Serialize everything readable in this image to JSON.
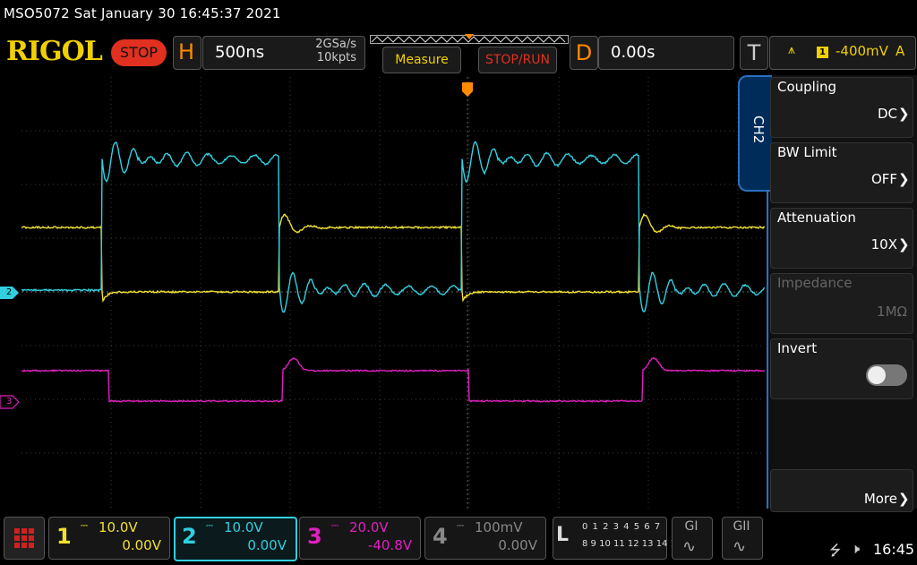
{
  "title": "MSO5072  Sat January 30 16:45:37 2021",
  "brand": "RIGOL",
  "run_state": "STOP",
  "horizontal": {
    "letter": "H",
    "timebase": "500ns",
    "sample_rate": "2GSa/s",
    "memory_depth": "10kpts"
  },
  "buttons": {
    "measure": "Measure",
    "stop_run": "STOP/RUN"
  },
  "delay": {
    "letter": "D",
    "value": "0.00s"
  },
  "trigger": {
    "letter": "T",
    "source": "1",
    "level": "-400mV",
    "mode": "A"
  },
  "side_menu": {
    "channel_tab": "CH2",
    "items": [
      {
        "label": "Coupling",
        "value": "DC"
      },
      {
        "label": "BW Limit",
        "value": "OFF"
      },
      {
        "label": "Attenuation",
        "value": "10X"
      },
      {
        "label": "Impedance",
        "value": "1MΩ"
      },
      {
        "label": "Invert",
        "value": ""
      },
      {
        "label": "",
        "value": "More"
      }
    ]
  },
  "channels": [
    {
      "num": "1",
      "scale": "10.0V",
      "offset": "0.00V",
      "color": "#f0e030"
    },
    {
      "num": "2",
      "scale": "10.0V",
      "offset": "0.00V",
      "color": "#30d0e0"
    },
    {
      "num": "3",
      "scale": "20.0V",
      "offset": "-40.8V",
      "color": "#e020c0"
    },
    {
      "num": "4",
      "scale": "100mV",
      "offset": "0.00V",
      "color": "#888888"
    }
  ],
  "markers": {
    "ch2": "2",
    "ch3": "3"
  },
  "logic": {
    "letter": "L",
    "row1": "0 1 2 3  4 5 6 7",
    "row2": "8 9 10 11 12 13 14 15"
  },
  "generators": {
    "g1": "GI",
    "g2": "GII"
  },
  "status": {
    "time": "16:45"
  }
}
